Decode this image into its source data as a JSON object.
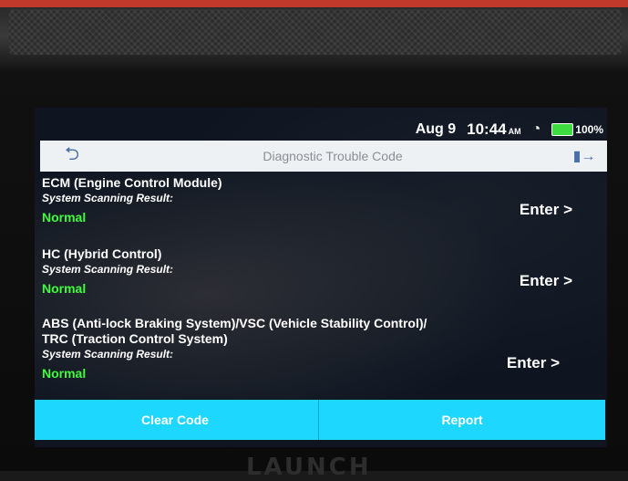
{
  "status_bar": {
    "date": "Aug 9",
    "time": "10:44",
    "ampm": "AM",
    "wifi_icon": "wifi-icon",
    "battery": "100%"
  },
  "header": {
    "back_icon": "back-arrow-icon",
    "title": "Diagnostic Trouble Code",
    "exit_icon": "exit-icon"
  },
  "modules": [
    {
      "name": "ECM (Engine Control Module)",
      "scan_label": "System Scanning Result:",
      "result": "Normal",
      "enter_label": "Enter >"
    },
    {
      "name": "HC (Hybrid Control)",
      "scan_label": "System Scanning Result:",
      "result": "Normal",
      "enter_label": "Enter >"
    },
    {
      "name": "ABS (Anti-lock Braking System)/VSC (Vehicle Stability Control)/",
      "name_line2": "TRC (Traction Control System)",
      "scan_label": "System Scanning Result:",
      "result": "Normal",
      "enter_label": "Enter >"
    }
  ],
  "actions": {
    "clear_code": "Clear Code",
    "report": "Report"
  },
  "brand": "LAUNCH",
  "colors": {
    "accent": "#1ed7ff",
    "normal_status": "#3cff3c",
    "header_bg": "#eef1f4",
    "screen_bg": "#0e1521"
  }
}
